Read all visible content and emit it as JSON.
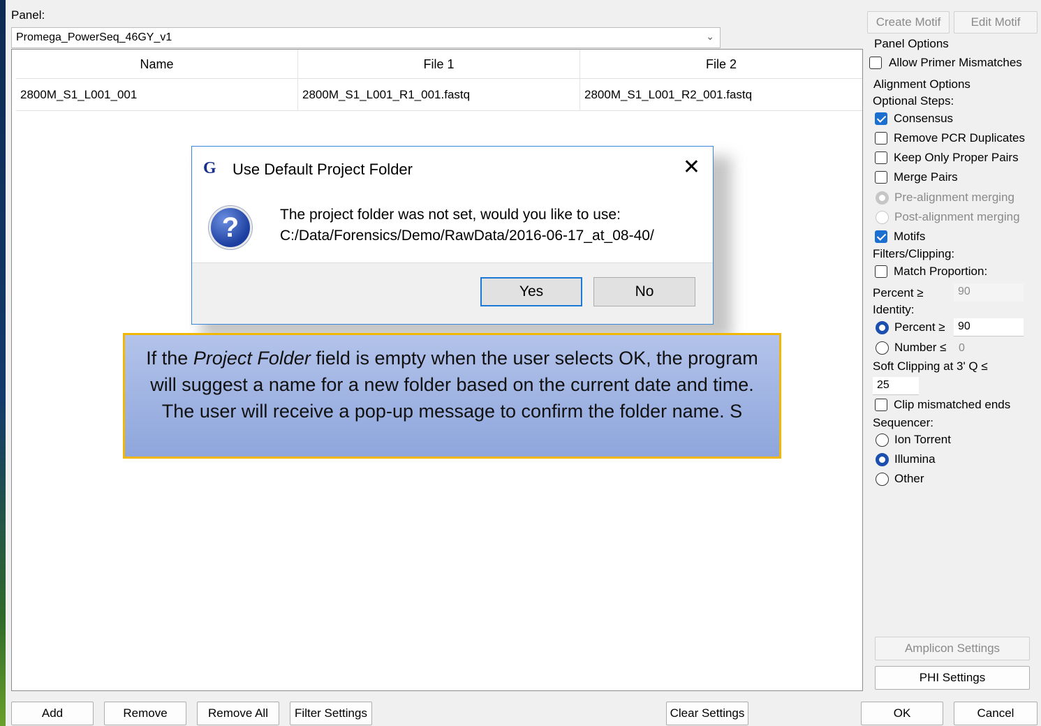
{
  "panel": {
    "label": "Panel:",
    "selected": "Promega_PowerSeq_46GY_v1"
  },
  "table": {
    "columns": [
      "Name",
      "File 1",
      "File 2"
    ],
    "rows": [
      [
        "2800M_S1_L001_001",
        "2800M_S1_L001_R1_001.fastq",
        "2800M_S1_L001_R2_001.fastq"
      ]
    ]
  },
  "right": {
    "create_motif": "Create Motif",
    "edit_motif": "Edit Motif",
    "panel_options": "Panel Options",
    "allow_primer_mismatches": "Allow Primer Mismatches",
    "alignment_options": "Alignment Options",
    "optional_steps": "Optional Steps:",
    "consensus": "Consensus",
    "remove_pcr": "Remove PCR Duplicates",
    "keep_proper": "Keep Only Proper Pairs",
    "merge_pairs": "Merge Pairs",
    "pre_merge": "Pre-alignment merging",
    "post_merge": "Post-alignment merging",
    "motifs": "Motifs",
    "filters": "Filters/Clipping:",
    "match_proportion": "Match Proportion:",
    "percent_label": "Percent ≥",
    "match_percent_value": "90",
    "identity": "Identity:",
    "id_percent": "Percent ≥",
    "id_percent_value": "90",
    "id_number": "Number ≤",
    "id_number_value": "0",
    "soft_clipping": "Soft Clipping at 3' Q ≤",
    "soft_clip_value": "25",
    "clip_mismatched": "Clip mismatched ends",
    "sequencer": "Sequencer:",
    "ion_torrent": "Ion Torrent",
    "illumina": "Illumina",
    "other": "Other",
    "amplicon_settings": "Amplicon Settings",
    "phi_settings": "PHI Settings"
  },
  "bottom": {
    "add": "Add",
    "remove": "Remove",
    "remove_all": "Remove All",
    "filter_settings": "Filter Settings",
    "clear_settings": "Clear Settings",
    "ok": "OK",
    "cancel": "Cancel"
  },
  "dialog": {
    "title": "Use Default Project Folder",
    "app_glyph": "G",
    "message_line1": "The project folder was not set, would you like to use:",
    "message_line2": "C:/Data/Forensics/Demo/RawData/2016-06-17_at_08-40/",
    "yes": "Yes",
    "no": "No"
  },
  "callout": {
    "before": "If the ",
    "italic": "Project Folder",
    "after": " field is empty when the user selects OK, the program will suggest a name for a new folder based on the current date and time.  The user will receive a pop-up message to confirm the folder name. S"
  }
}
